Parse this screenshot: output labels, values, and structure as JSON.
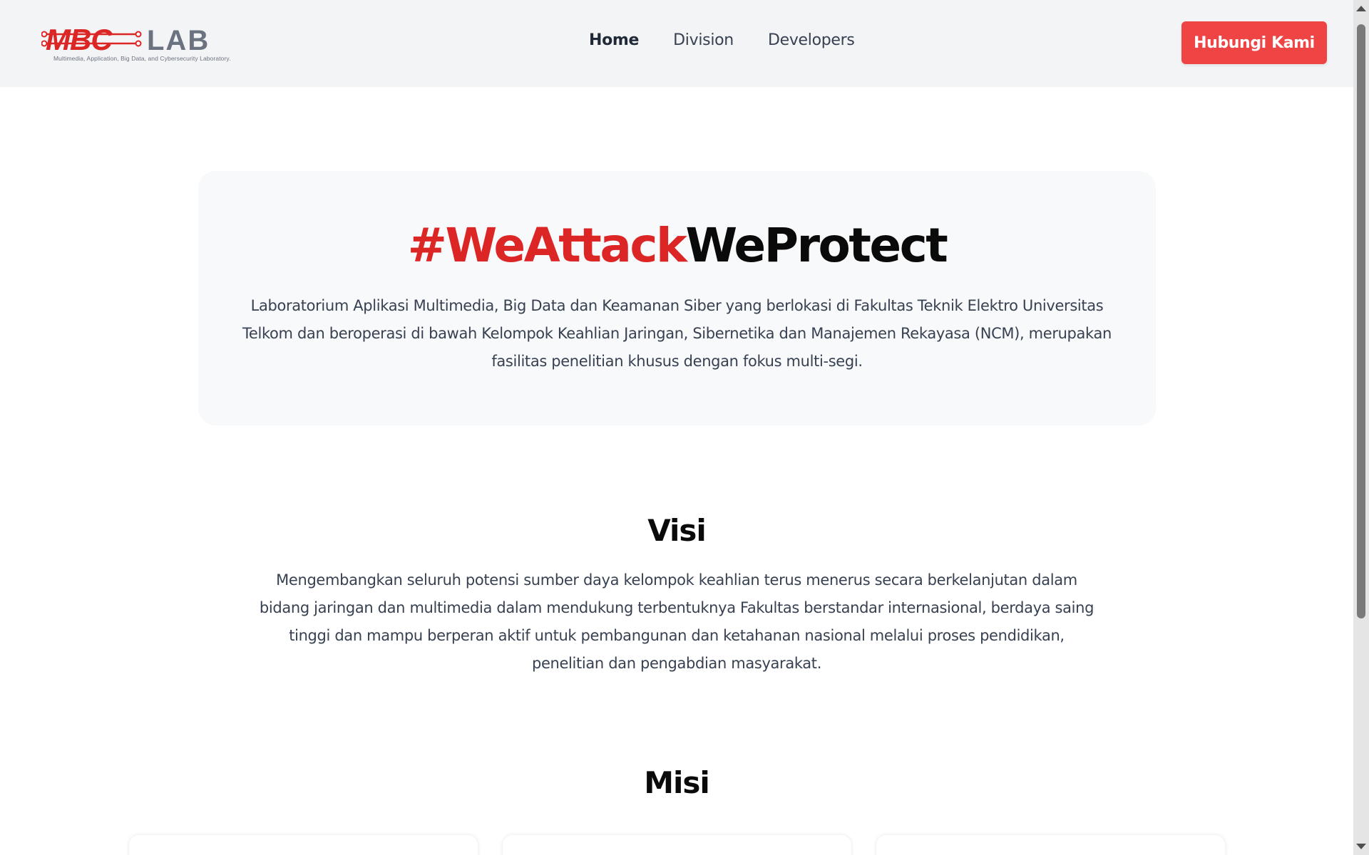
{
  "colors": {
    "accent": "#dc2626",
    "button": "#ef4444",
    "navbar_bg": "#f3f4f6",
    "card_bg": "#f8f9fa"
  },
  "logo": {
    "brand": "MBC",
    "lab": "LAB",
    "tagline": "Multimedia, Application, Big Data, and Cybersecurity Laboratory."
  },
  "nav": {
    "links": [
      {
        "label": "Home",
        "active": true
      },
      {
        "label": "Division",
        "active": false
      },
      {
        "label": "Developers",
        "active": false
      }
    ],
    "cta_label": "Hubungi Kami"
  },
  "hero": {
    "title_accent": "#WeAttack",
    "title_dark": "WeProtect",
    "description": "Laboratorium Aplikasi Multimedia, Big Data dan Keamanan Siber yang berlokasi di Fakultas Teknik Elektro Universitas Telkom dan beroperasi di bawah Kelompok Keahlian Jaringan, Sibernetika dan Manajemen Rekayasa (NCM), merupakan fasilitas penelitian khusus dengan fokus multi-segi."
  },
  "visi": {
    "title": "Visi",
    "text": "Mengembangkan seluruh potensi sumber daya kelompok keahlian terus menerus secara berkelanjutan dalam bidang jaringan dan multimedia dalam mendukung terbentuknya Fakultas berstandar internasional, berdaya saing tinggi dan mampu berperan aktif untuk pembangunan dan ketahanan nasional melalui proses pendidikan, penelitian dan pengabdian masyarakat."
  },
  "misi": {
    "title": "Misi"
  }
}
